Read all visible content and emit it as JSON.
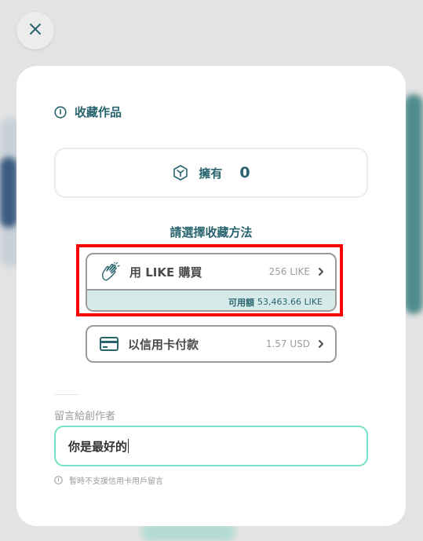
{
  "dialog": {
    "title": "收藏作品",
    "own_label": "擁有",
    "own_count": "0",
    "choose_method": "請選擇收藏方法",
    "like_option": {
      "label": "用 LIKE 購買",
      "price": "256 LIKE",
      "balance_label": "可用額",
      "balance_value": "53,463.66 LIKE"
    },
    "card_option": {
      "label": "以信用卡付款",
      "price": "1.57 USD"
    },
    "message_label": "留言給創作者",
    "message_value": "你是最好的",
    "card_note": "暫時不支援信用卡用戶留言"
  },
  "colors": {
    "accent": "#28646e",
    "highlight_border": "#ff0000",
    "input_border": "#74e0c8",
    "balance_bg": "#d7eaea"
  },
  "icons": [
    "close-icon",
    "info-icon",
    "nft-icon",
    "clapping-hand-icon",
    "chevron-right-icon",
    "credit-card-icon"
  ]
}
